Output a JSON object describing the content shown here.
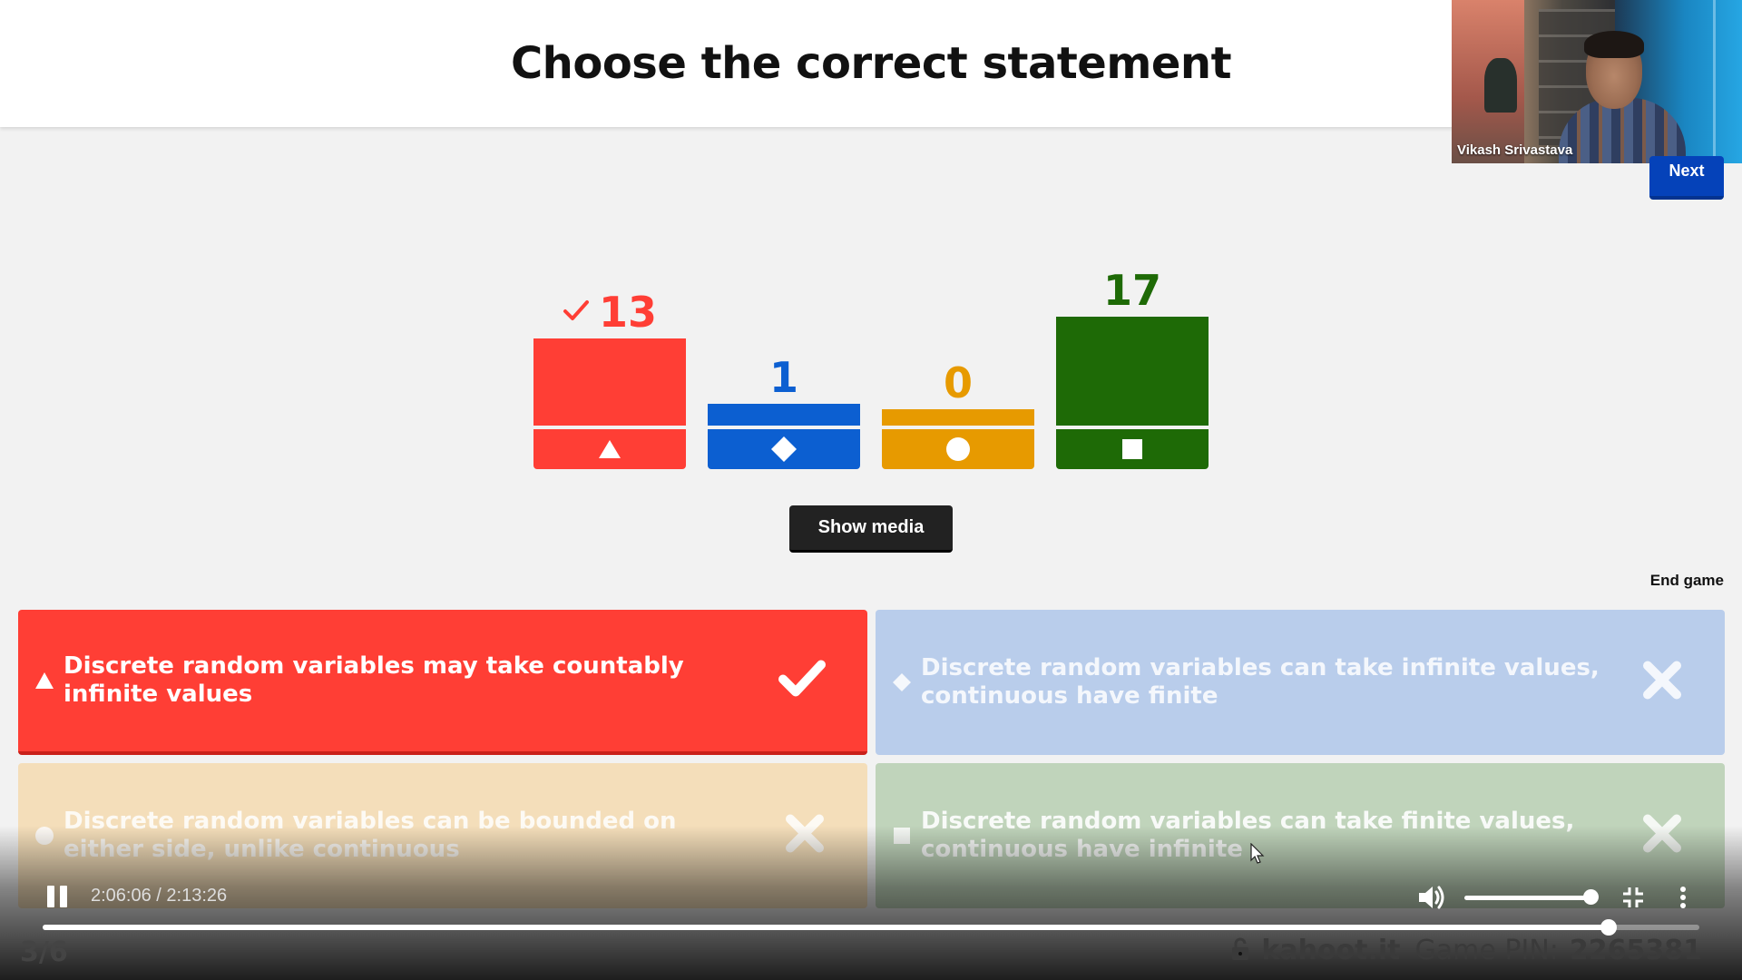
{
  "question": {
    "title": "Choose the correct statement"
  },
  "webcam": {
    "name": "Vikash Srivastava"
  },
  "buttons": {
    "next": "Next",
    "show_media": "Show media",
    "end_game": "End game"
  },
  "chart_data": {
    "type": "bar",
    "categories": [
      "triangle",
      "diamond",
      "circle",
      "square"
    ],
    "values": [
      13,
      1,
      0,
      17
    ],
    "colors": [
      "#ff3e35",
      "#0c5fd1",
      "#e79a00",
      "#1e6a06"
    ],
    "correct_index": 0,
    "ylim": [
      0,
      17
    ]
  },
  "answers": [
    {
      "shape": "triangle",
      "text": "Discrete random variables may take countably infinite values",
      "correct": true,
      "mark": "check-icon"
    },
    {
      "shape": "diamond",
      "text": "Discrete random variables can take infinite values, continuous have finite",
      "correct": false,
      "mark": "x-icon"
    },
    {
      "shape": "circle",
      "text": "Discrete random variables can be bounded on either side, unlike continuous",
      "correct": false,
      "mark": "x-icon"
    },
    {
      "shape": "square",
      "text": "Discrete random variables can take finite values, continuous have infinite",
      "correct": false,
      "mark": "x-icon"
    }
  ],
  "player": {
    "time": "2:06:06 / 2:13:26",
    "progress": 0.9451,
    "volume": 0.9
  },
  "footer": {
    "counter": "3/6",
    "brand": "kahoot.it",
    "pin_label": "Game PIN:",
    "pin": "2265381"
  }
}
